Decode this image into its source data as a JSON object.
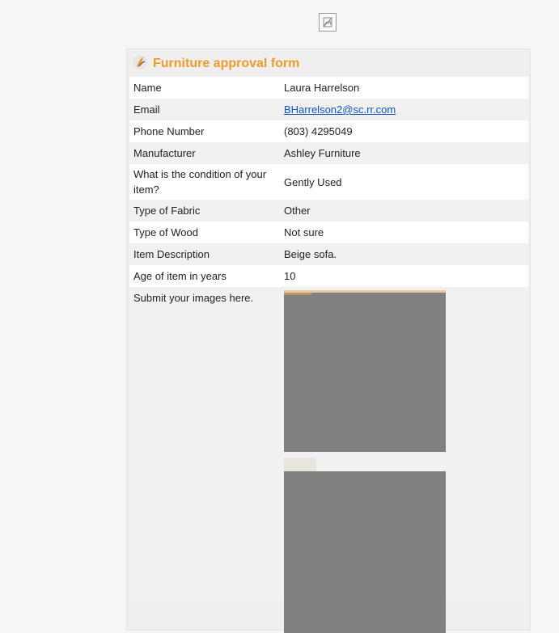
{
  "header_image": {
    "icon": "broken-image-icon"
  },
  "form": {
    "logo_icon": "feather-logo-icon",
    "title": "Furniture approval form",
    "accent_color": "#f39a2d",
    "rows": [
      {
        "label": "Name",
        "value": "Laura Harrelson"
      },
      {
        "label": "Email",
        "value": "BHarrelson2@sc.rr.com"
      },
      {
        "label": "Phone Number",
        "value": "(803) 4295049"
      },
      {
        "label": "Manufacturer",
        "value": "Ashley Furniture"
      },
      {
        "label": "What is the condition of your item?",
        "value": "Gently Used"
      },
      {
        "label": "Type of Fabric",
        "value": "Other"
      },
      {
        "label": "Type of Wood",
        "value": "Not sure"
      },
      {
        "label": "Item Description",
        "value": "Beige sofa."
      },
      {
        "label": "Age of item in years",
        "value": "10"
      },
      {
        "label": "Submit your images here.",
        "value": ""
      }
    ]
  }
}
